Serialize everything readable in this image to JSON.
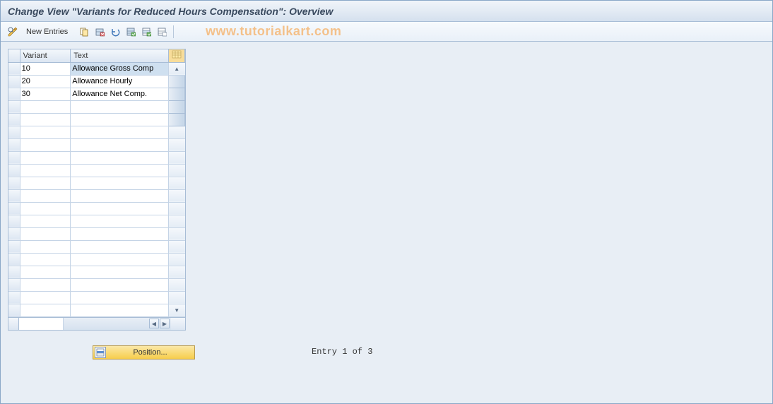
{
  "title": "Change View \"Variants for Reduced Hours Compensation\": Overview",
  "toolbar": {
    "new_entries": "New Entries"
  },
  "watermark": "www.tutorialkart.com",
  "table": {
    "columns": {
      "variant": "Variant",
      "text": "Text"
    },
    "rows": [
      {
        "variant": "10",
        "text": "Allowance Gross Comp"
      },
      {
        "variant": "20",
        "text": "Allowance Hourly"
      },
      {
        "variant": "30",
        "text": "Allowance Net Comp."
      }
    ]
  },
  "footer": {
    "position_label": "Position...",
    "entry_counter": "Entry 1 of 3"
  }
}
